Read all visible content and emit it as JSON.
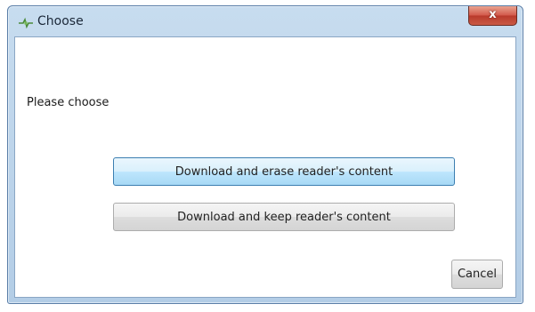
{
  "window": {
    "title": "Choose",
    "close_label": "x"
  },
  "dialog": {
    "prompt": "Please choose",
    "buttons": {
      "erase": "Download and erase reader's content",
      "keep": "Download and keep reader's content",
      "cancel": "Cancel"
    }
  },
  "icons": {
    "app": "app-icon",
    "close": "close-icon"
  },
  "colors": {
    "titlebar": "#b9d1ea",
    "close_button": "#c9473a",
    "focus_border": "#3c7fb1"
  }
}
